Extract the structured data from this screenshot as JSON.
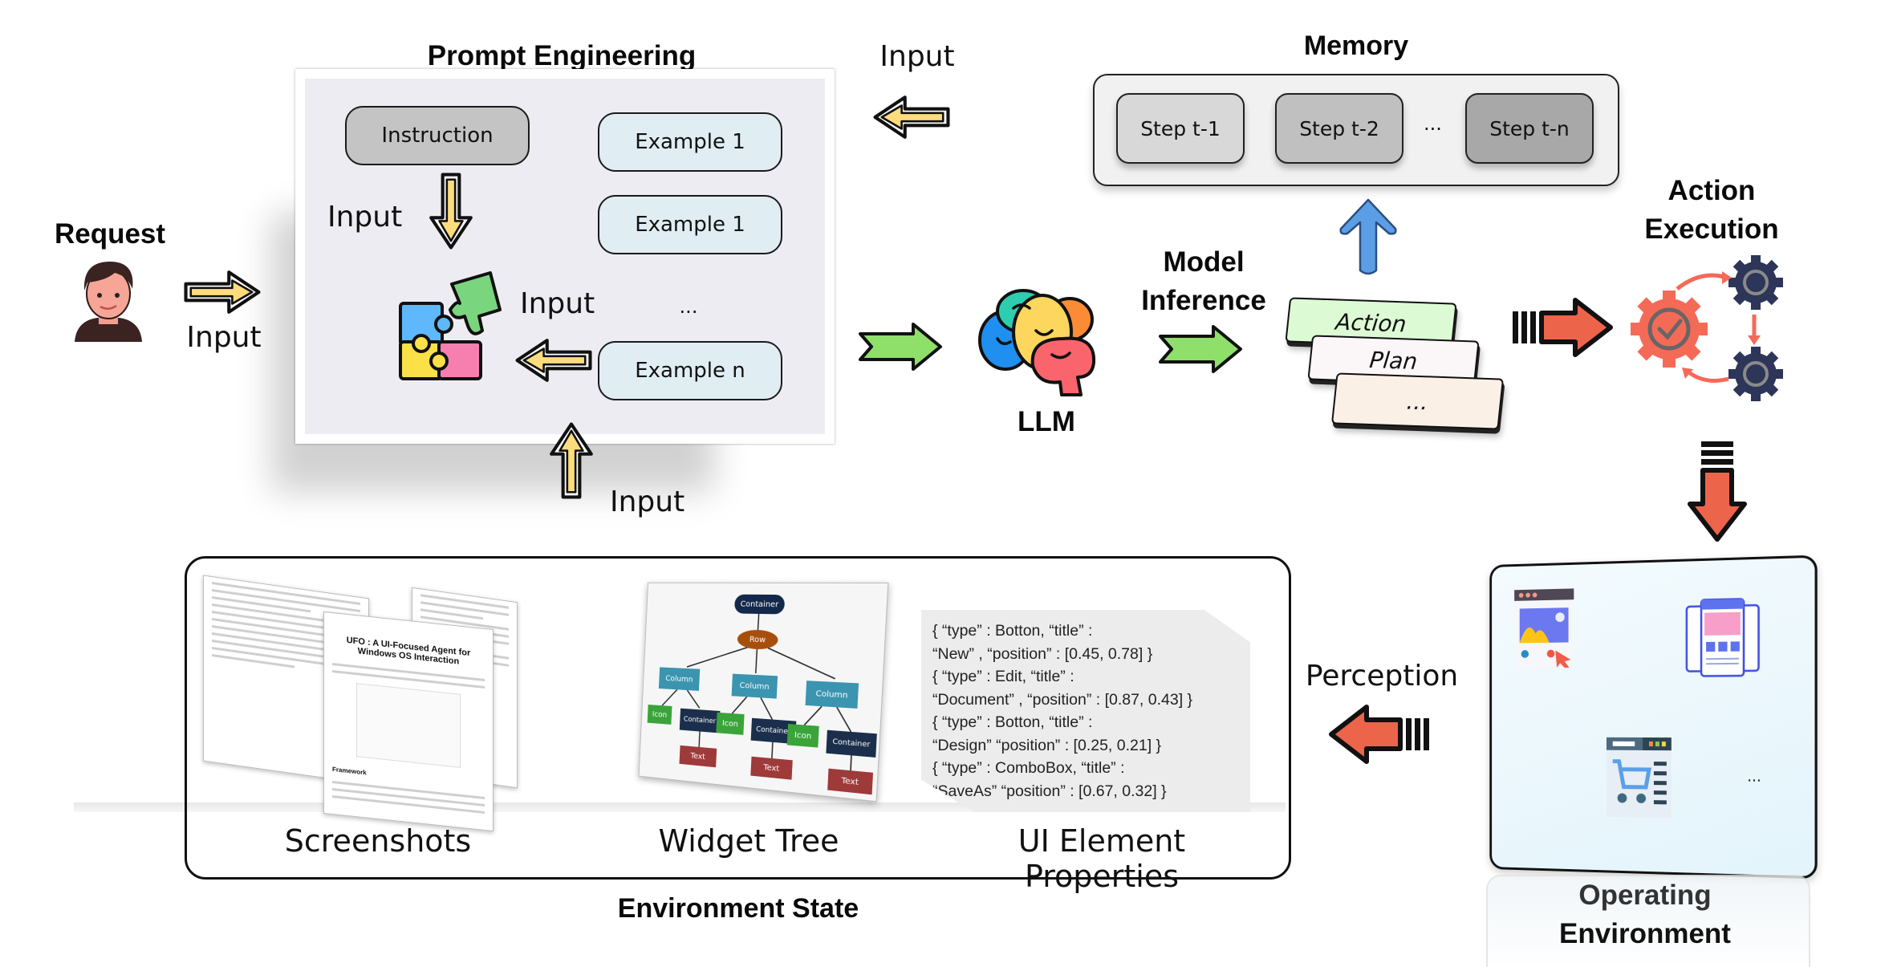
{
  "request": {
    "title": "Request",
    "input_label": "Input",
    "icon": "person-avatar-icon"
  },
  "prompt_engineering": {
    "title": "Prompt Engineering",
    "instruction": "Instruction",
    "examples": [
      "Example 1",
      "Example 1",
      "...",
      "Example n"
    ],
    "input_label_down": "Input",
    "input_label_left": "Input",
    "icon": "puzzle-icon"
  },
  "memory_input": {
    "label": "Input"
  },
  "llm": {
    "label": "LLM",
    "icon": "brain-icon"
  },
  "model_inference": {
    "title_line1": "Model",
    "title_line2": "Inference"
  },
  "memory": {
    "title": "Memory",
    "steps": [
      "Step t-1",
      "Step t-2",
      "...",
      "Step t-n"
    ]
  },
  "outputs": {
    "cards": [
      "Action",
      "Plan",
      "..."
    ]
  },
  "action_execution": {
    "title_line1": "Action",
    "title_line2": "Execution",
    "icon": "gears-cycle-icon"
  },
  "operating_environment": {
    "title_line1": "Operating",
    "title_line2": "Environment",
    "ellipsis": "..."
  },
  "perception": {
    "label": "Perception"
  },
  "environment_state": {
    "title": "Environment State",
    "input_label": "Input",
    "screenshots_label": "Screenshots",
    "screenshot_heading": "UFO : A UI-Focused Agent for Windows OS Interaction",
    "screenshot_section": "Framework",
    "widget_tree_label": "Widget Tree",
    "widget_tree": {
      "root": "Container",
      "row": "Row",
      "columns": [
        {
          "label": "Column",
          "icon": "Icon",
          "container": "Container",
          "text": "Text"
        },
        {
          "label": "Column",
          "icon": "Icon",
          "container": "Container",
          "text": "Text"
        },
        {
          "label": "Column",
          "icon": "Icon",
          "container": "Container",
          "text": "Text"
        }
      ]
    },
    "ui_props_label": "UI Element Properties",
    "ui_props_lines": [
      "{ “type” : Botton, “title” :",
      " “New” , “position” : [0.45, 0.78] }",
      "{ “type” : Edit, “title” :",
      " “Document” , “position” : [0.87, 0.43] }",
      "{ “type” : Botton, “title” :",
      " “Design”  “position” : [0.25, 0.21] }",
      "{ “type” : ComboBox, “title” :",
      " “SaveAs”  “position” : [0.67, 0.32] }"
    ]
  },
  "colors": {
    "yellow_arrow": "#fcdc7c",
    "green_arrow": "#8ee06a",
    "red_arrow": "#ec654b",
    "blue_arrow": "#5b9ee6",
    "instruction_fill": "#c4c4c4",
    "example_fill": "#e0eef4",
    "gear_navy": "#2d3558",
    "gear_red": "#f56a57"
  }
}
